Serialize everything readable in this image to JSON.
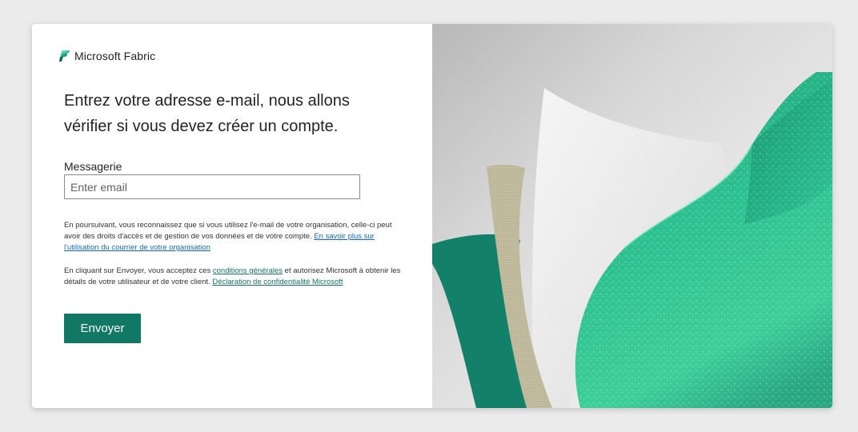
{
  "brand": {
    "name": "Microsoft Fabric",
    "logo_icon": "fabric-logo-icon"
  },
  "heading": "Entrez votre adresse e-mail, nous allons vérifier si vous devez créer un compte.",
  "email": {
    "label": "Messagerie",
    "placeholder": "Enter email",
    "value": ""
  },
  "notice_org": {
    "text": "En poursuivant, vous reconnaissez que si vous utilisez l'e-mail de votre organisation, celle-ci peut avoir des droits d'accès et de gestion de vos données et de votre compte. ",
    "link": "En savoir plus sur l'utilisation du courrier de votre organisation"
  },
  "notice_terms": {
    "text_before": "En cliquant sur Envoyer, vous acceptez ces ",
    "terms_link": "conditions générales",
    "text_middle": " et autorisez Microsoft à obtenir les détails de votre utilisateur et de votre client. ",
    "privacy_link": "Déclaration de confidentialité Microsoft"
  },
  "submit": {
    "label": "Envoyer"
  },
  "colors": {
    "accent": "#117865",
    "link": "#0f6cbd",
    "background": "#ebebeb"
  },
  "hero_image": {
    "description_icon": "fabric-hero-illustration"
  }
}
